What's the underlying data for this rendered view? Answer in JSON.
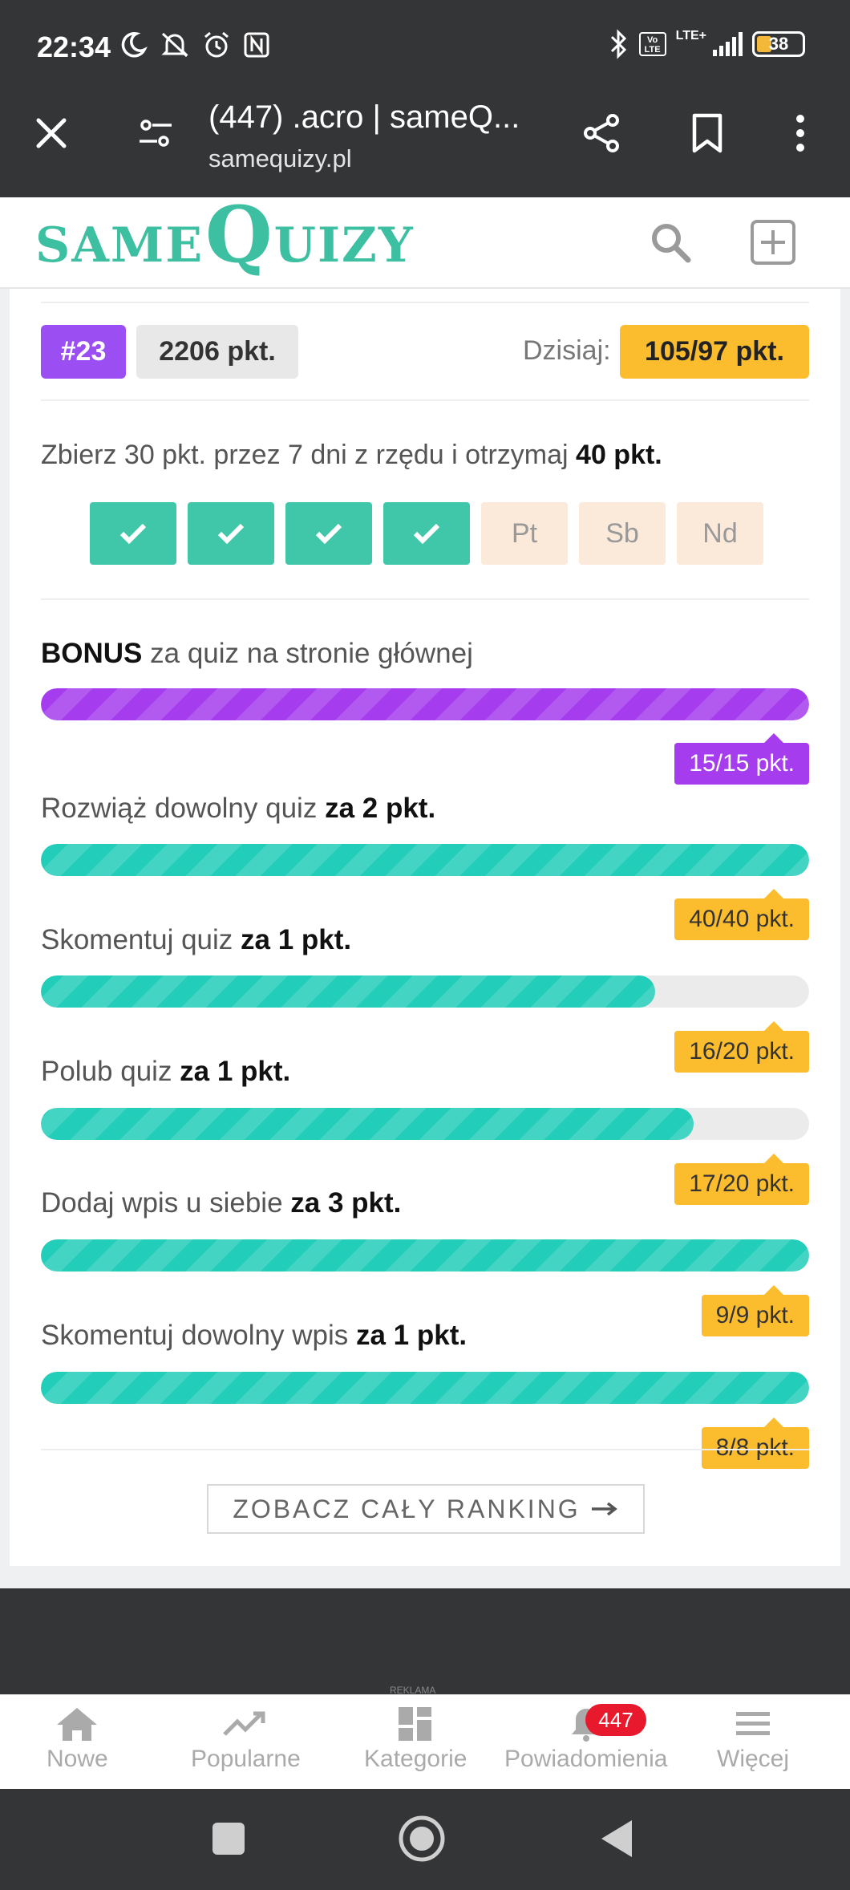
{
  "status_bar": {
    "time": "22:34",
    "network": "LTE+",
    "volte": "Vo LTE",
    "battery": "38"
  },
  "browser": {
    "tab_title": "(447) .acro | sameQ...",
    "domain": "samequizy.pl"
  },
  "site": {
    "logo_prefix": "SAME",
    "logo_big": "Q",
    "logo_suffix": "UIZY"
  },
  "summary": {
    "rank": "#23",
    "points": "2206 pkt.",
    "today_label": "Dzisiaj:",
    "today_value": "105/97 pkt."
  },
  "streak": {
    "text": "Zbierz 30 pkt. przez 7 dni z rzędu i otrzymaj ",
    "reward": "40 pkt.",
    "days": [
      {
        "label": "",
        "done": true
      },
      {
        "label": "",
        "done": true
      },
      {
        "label": "",
        "done": true
      },
      {
        "label": "",
        "done": true
      },
      {
        "label": "Pt",
        "done": false
      },
      {
        "label": "Sb",
        "done": false
      },
      {
        "label": "Nd",
        "done": false
      }
    ]
  },
  "tasks": [
    {
      "prefix": "BONUS",
      "text": " za quiz na stronie głównej",
      "bold": "",
      "progress": 1.0,
      "tag": "15/15 pkt.",
      "color": "#a53cee"
    },
    {
      "prefix": "",
      "text": "Rozwiąż dowolny quiz ",
      "bold": "za 2 pkt.",
      "progress": 1.0,
      "tag": "40/40 pkt.",
      "color": "#22cdb9"
    },
    {
      "prefix": "",
      "text": "Skomentuj quiz ",
      "bold": "za 1 pkt.",
      "progress": 0.8,
      "tag": "16/20 pkt.",
      "color": "#22cdb9"
    },
    {
      "prefix": "",
      "text": "Polub quiz ",
      "bold": "za 1 pkt.",
      "progress": 0.85,
      "tag": "17/20 pkt.",
      "color": "#22cdb9"
    },
    {
      "prefix": "",
      "text": "Dodaj wpis u siebie ",
      "bold": "za 3 pkt.",
      "progress": 1.0,
      "tag": "9/9 pkt.",
      "color": "#22cdb9"
    },
    {
      "prefix": "",
      "text": "Skomentuj dowolny wpis ",
      "bold": "za 1 pkt.",
      "progress": 1.0,
      "tag": "8/8 pkt.",
      "color": "#22cdb9"
    }
  ],
  "ranking_button": "ZOBACZ CAŁY RANKING",
  "ad_label": "REKLAMA",
  "bottom_nav": {
    "items": [
      {
        "label": "Nowe",
        "icon": "home-icon"
      },
      {
        "label": "Popularne",
        "icon": "trending-icon"
      },
      {
        "label": "Kategorie",
        "icon": "grid-icon"
      },
      {
        "label": "Powiadomienia",
        "icon": "bell-icon"
      },
      {
        "label": "Więcej",
        "icon": "menu-icon"
      }
    ],
    "notification_count": "447"
  }
}
